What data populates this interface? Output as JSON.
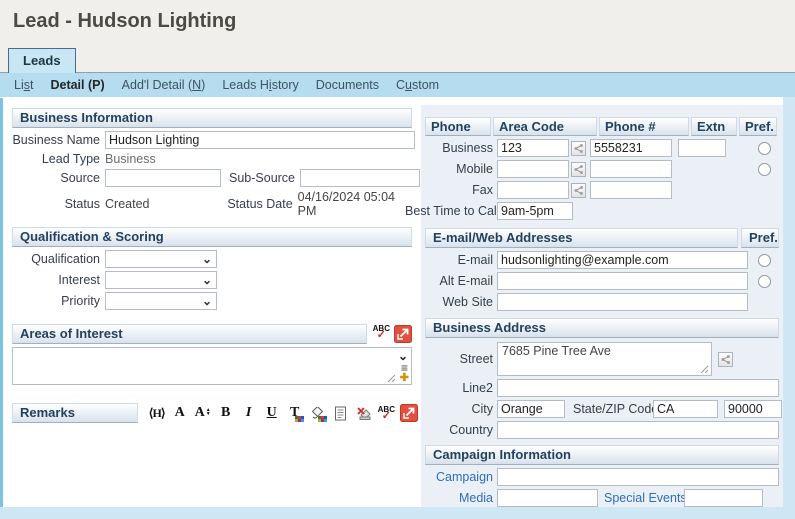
{
  "theme": {
    "accent_blue": "#2e6fbd",
    "tab_bar": "#b5dcef",
    "panel_bg": "#ebeff6",
    "canvas": "#cfe7f5",
    "header_text": "#24425e",
    "expand_red": "#e4503e"
  },
  "page": {
    "title": "Lead - Hudson Lighting"
  },
  "tab": {
    "label": "Leads"
  },
  "subnav": [
    {
      "pre": "Li",
      "key": "s",
      "post": "t"
    },
    {
      "pre": "Detail (P)",
      "key": "",
      "post": ""
    },
    {
      "pre": "Add'l Detail (",
      "key": "N",
      "post": ")"
    },
    {
      "pre": "Leads H",
      "key": "i",
      "post": "story"
    },
    {
      "pre": "Documents",
      "key": "",
      "post": ""
    },
    {
      "pre": "C",
      "key": "u",
      "post": "stom"
    }
  ],
  "business_info": {
    "header": "Business Information",
    "business_name_label": "Business Name",
    "business_name": "Hudson Lighting",
    "lead_type_label": "Lead Type",
    "lead_type": "Business",
    "source_label": "Source",
    "source": "",
    "sub_source_label": "Sub-Source",
    "sub_source": "",
    "status_label": "Status",
    "status": "Created",
    "status_date_label": "Status Date",
    "status_date": "04/16/2024 05:04 PM"
  },
  "qualification": {
    "header": "Qualification & Scoring",
    "qualification_label": "Qualification",
    "qualification_value": "",
    "interest_label": "Interest",
    "interest_value": "",
    "priority_label": "Priority",
    "priority_value": ""
  },
  "areas_of_interest": {
    "header": "Areas of Interest",
    "value": ""
  },
  "remarks": {
    "header": "Remarks",
    "value": ""
  },
  "phone": {
    "col_phone": "Phone",
    "col_area_code": "Area Code",
    "col_phone_num": "Phone #",
    "col_extn": "Extn",
    "col_pref": "Pref.",
    "business_label": "Business",
    "business_area": "123",
    "business_number": "5558231",
    "business_extn": "",
    "mobile_label": "Mobile",
    "mobile_area": "",
    "mobile_number": "",
    "fax_label": "Fax",
    "fax_area": "",
    "fax_number": "",
    "best_time_label": "Best Time to Call",
    "best_time": "9am-5pm"
  },
  "email": {
    "header": "E-mail/Web Addresses",
    "pref": "Pref.",
    "email_label": "E-mail",
    "email": "hudsonlighting@example.com",
    "alt_email_label": "Alt E-mail",
    "alt_email": "",
    "web_site_label": "Web Site",
    "web_site": ""
  },
  "address": {
    "header": "Business Address",
    "street_label": "Street",
    "street": "7685 Pine Tree Ave",
    "line2_label": "Line2",
    "line2": "",
    "city_label": "City",
    "city": "Orange",
    "state_zip_label": "State/ZIP Code",
    "state": "CA",
    "zip": "90000",
    "country_label": "Country",
    "country": ""
  },
  "campaign": {
    "header": "Campaign Information",
    "campaign_label": "Campaign",
    "campaign": "",
    "media_label": "Media",
    "media": "",
    "special_events_label": "Special Events",
    "special_events": ""
  },
  "icons": {
    "heading": "⟨H⟩",
    "font": "A",
    "font_size": "A",
    "arrow_up": "▲",
    "arrow_down": "▼",
    "bold": "B",
    "italic": "I",
    "underline": "U",
    "text_color": "T",
    "spellcheck": "ABC",
    "check": "✓",
    "chevron_down": "⌄",
    "list_lines": "≡",
    "plus": "✚"
  }
}
